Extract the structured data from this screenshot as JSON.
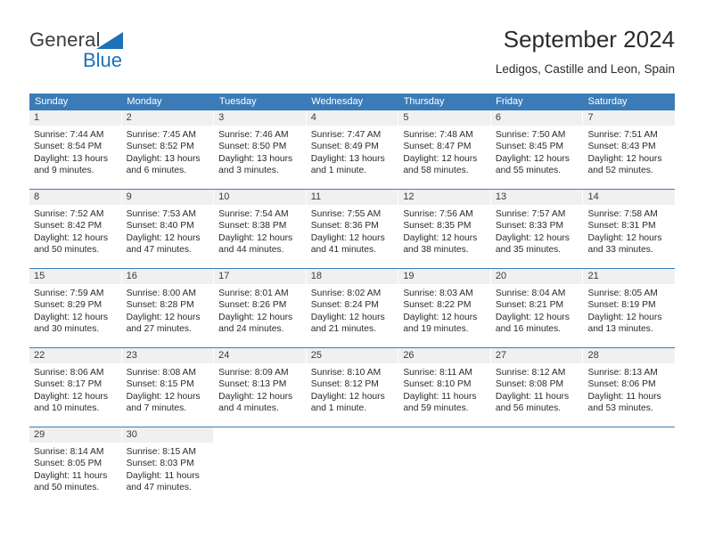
{
  "brand": {
    "name_part1": "General",
    "name_part2": "Blue",
    "accent_color": "#1d71b8"
  },
  "header": {
    "title": "September 2024",
    "subtitle": "Ledigos, Castille and Leon, Spain"
  },
  "calendar": {
    "header_bg_color": "#3b7cb8",
    "day_band_color": "#f0f0f0",
    "weekdays": [
      "Sunday",
      "Monday",
      "Tuesday",
      "Wednesday",
      "Thursday",
      "Friday",
      "Saturday"
    ],
    "weeks": [
      [
        {
          "day": "1",
          "sunrise": "Sunrise: 7:44 AM",
          "sunset": "Sunset: 8:54 PM",
          "daylight_line1": "Daylight: 13 hours",
          "daylight_line2": "and 9 minutes."
        },
        {
          "day": "2",
          "sunrise": "Sunrise: 7:45 AM",
          "sunset": "Sunset: 8:52 PM",
          "daylight_line1": "Daylight: 13 hours",
          "daylight_line2": "and 6 minutes."
        },
        {
          "day": "3",
          "sunrise": "Sunrise: 7:46 AM",
          "sunset": "Sunset: 8:50 PM",
          "daylight_line1": "Daylight: 13 hours",
          "daylight_line2": "and 3 minutes."
        },
        {
          "day": "4",
          "sunrise": "Sunrise: 7:47 AM",
          "sunset": "Sunset: 8:49 PM",
          "daylight_line1": "Daylight: 13 hours",
          "daylight_line2": "and 1 minute."
        },
        {
          "day": "5",
          "sunrise": "Sunrise: 7:48 AM",
          "sunset": "Sunset: 8:47 PM",
          "daylight_line1": "Daylight: 12 hours",
          "daylight_line2": "and 58 minutes."
        },
        {
          "day": "6",
          "sunrise": "Sunrise: 7:50 AM",
          "sunset": "Sunset: 8:45 PM",
          "daylight_line1": "Daylight: 12 hours",
          "daylight_line2": "and 55 minutes."
        },
        {
          "day": "7",
          "sunrise": "Sunrise: 7:51 AM",
          "sunset": "Sunset: 8:43 PM",
          "daylight_line1": "Daylight: 12 hours",
          "daylight_line2": "and 52 minutes."
        }
      ],
      [
        {
          "day": "8",
          "sunrise": "Sunrise: 7:52 AM",
          "sunset": "Sunset: 8:42 PM",
          "daylight_line1": "Daylight: 12 hours",
          "daylight_line2": "and 50 minutes."
        },
        {
          "day": "9",
          "sunrise": "Sunrise: 7:53 AM",
          "sunset": "Sunset: 8:40 PM",
          "daylight_line1": "Daylight: 12 hours",
          "daylight_line2": "and 47 minutes."
        },
        {
          "day": "10",
          "sunrise": "Sunrise: 7:54 AM",
          "sunset": "Sunset: 8:38 PM",
          "daylight_line1": "Daylight: 12 hours",
          "daylight_line2": "and 44 minutes."
        },
        {
          "day": "11",
          "sunrise": "Sunrise: 7:55 AM",
          "sunset": "Sunset: 8:36 PM",
          "daylight_line1": "Daylight: 12 hours",
          "daylight_line2": "and 41 minutes."
        },
        {
          "day": "12",
          "sunrise": "Sunrise: 7:56 AM",
          "sunset": "Sunset: 8:35 PM",
          "daylight_line1": "Daylight: 12 hours",
          "daylight_line2": "and 38 minutes."
        },
        {
          "day": "13",
          "sunrise": "Sunrise: 7:57 AM",
          "sunset": "Sunset: 8:33 PM",
          "daylight_line1": "Daylight: 12 hours",
          "daylight_line2": "and 35 minutes."
        },
        {
          "day": "14",
          "sunrise": "Sunrise: 7:58 AM",
          "sunset": "Sunset: 8:31 PM",
          "daylight_line1": "Daylight: 12 hours",
          "daylight_line2": "and 33 minutes."
        }
      ],
      [
        {
          "day": "15",
          "sunrise": "Sunrise: 7:59 AM",
          "sunset": "Sunset: 8:29 PM",
          "daylight_line1": "Daylight: 12 hours",
          "daylight_line2": "and 30 minutes."
        },
        {
          "day": "16",
          "sunrise": "Sunrise: 8:00 AM",
          "sunset": "Sunset: 8:28 PM",
          "daylight_line1": "Daylight: 12 hours",
          "daylight_line2": "and 27 minutes."
        },
        {
          "day": "17",
          "sunrise": "Sunrise: 8:01 AM",
          "sunset": "Sunset: 8:26 PM",
          "daylight_line1": "Daylight: 12 hours",
          "daylight_line2": "and 24 minutes."
        },
        {
          "day": "18",
          "sunrise": "Sunrise: 8:02 AM",
          "sunset": "Sunset: 8:24 PM",
          "daylight_line1": "Daylight: 12 hours",
          "daylight_line2": "and 21 minutes."
        },
        {
          "day": "19",
          "sunrise": "Sunrise: 8:03 AM",
          "sunset": "Sunset: 8:22 PM",
          "daylight_line1": "Daylight: 12 hours",
          "daylight_line2": "and 19 minutes."
        },
        {
          "day": "20",
          "sunrise": "Sunrise: 8:04 AM",
          "sunset": "Sunset: 8:21 PM",
          "daylight_line1": "Daylight: 12 hours",
          "daylight_line2": "and 16 minutes."
        },
        {
          "day": "21",
          "sunrise": "Sunrise: 8:05 AM",
          "sunset": "Sunset: 8:19 PM",
          "daylight_line1": "Daylight: 12 hours",
          "daylight_line2": "and 13 minutes."
        }
      ],
      [
        {
          "day": "22",
          "sunrise": "Sunrise: 8:06 AM",
          "sunset": "Sunset: 8:17 PM",
          "daylight_line1": "Daylight: 12 hours",
          "daylight_line2": "and 10 minutes."
        },
        {
          "day": "23",
          "sunrise": "Sunrise: 8:08 AM",
          "sunset": "Sunset: 8:15 PM",
          "daylight_line1": "Daylight: 12 hours",
          "daylight_line2": "and 7 minutes."
        },
        {
          "day": "24",
          "sunrise": "Sunrise: 8:09 AM",
          "sunset": "Sunset: 8:13 PM",
          "daylight_line1": "Daylight: 12 hours",
          "daylight_line2": "and 4 minutes."
        },
        {
          "day": "25",
          "sunrise": "Sunrise: 8:10 AM",
          "sunset": "Sunset: 8:12 PM",
          "daylight_line1": "Daylight: 12 hours",
          "daylight_line2": "and 1 minute."
        },
        {
          "day": "26",
          "sunrise": "Sunrise: 8:11 AM",
          "sunset": "Sunset: 8:10 PM",
          "daylight_line1": "Daylight: 11 hours",
          "daylight_line2": "and 59 minutes."
        },
        {
          "day": "27",
          "sunrise": "Sunrise: 8:12 AM",
          "sunset": "Sunset: 8:08 PM",
          "daylight_line1": "Daylight: 11 hours",
          "daylight_line2": "and 56 minutes."
        },
        {
          "day": "28",
          "sunrise": "Sunrise: 8:13 AM",
          "sunset": "Sunset: 8:06 PM",
          "daylight_line1": "Daylight: 11 hours",
          "daylight_line2": "and 53 minutes."
        }
      ],
      [
        {
          "day": "29",
          "sunrise": "Sunrise: 8:14 AM",
          "sunset": "Sunset: 8:05 PM",
          "daylight_line1": "Daylight: 11 hours",
          "daylight_line2": "and 50 minutes."
        },
        {
          "day": "30",
          "sunrise": "Sunrise: 8:15 AM",
          "sunset": "Sunset: 8:03 PM",
          "daylight_line1": "Daylight: 11 hours",
          "daylight_line2": "and 47 minutes."
        },
        {
          "day": "",
          "sunrise": "",
          "sunset": "",
          "daylight_line1": "",
          "daylight_line2": ""
        },
        {
          "day": "",
          "sunrise": "",
          "sunset": "",
          "daylight_line1": "",
          "daylight_line2": ""
        },
        {
          "day": "",
          "sunrise": "",
          "sunset": "",
          "daylight_line1": "",
          "daylight_line2": ""
        },
        {
          "day": "",
          "sunrise": "",
          "sunset": "",
          "daylight_line1": "",
          "daylight_line2": ""
        },
        {
          "day": "",
          "sunrise": "",
          "sunset": "",
          "daylight_line1": "",
          "daylight_line2": ""
        }
      ]
    ]
  }
}
